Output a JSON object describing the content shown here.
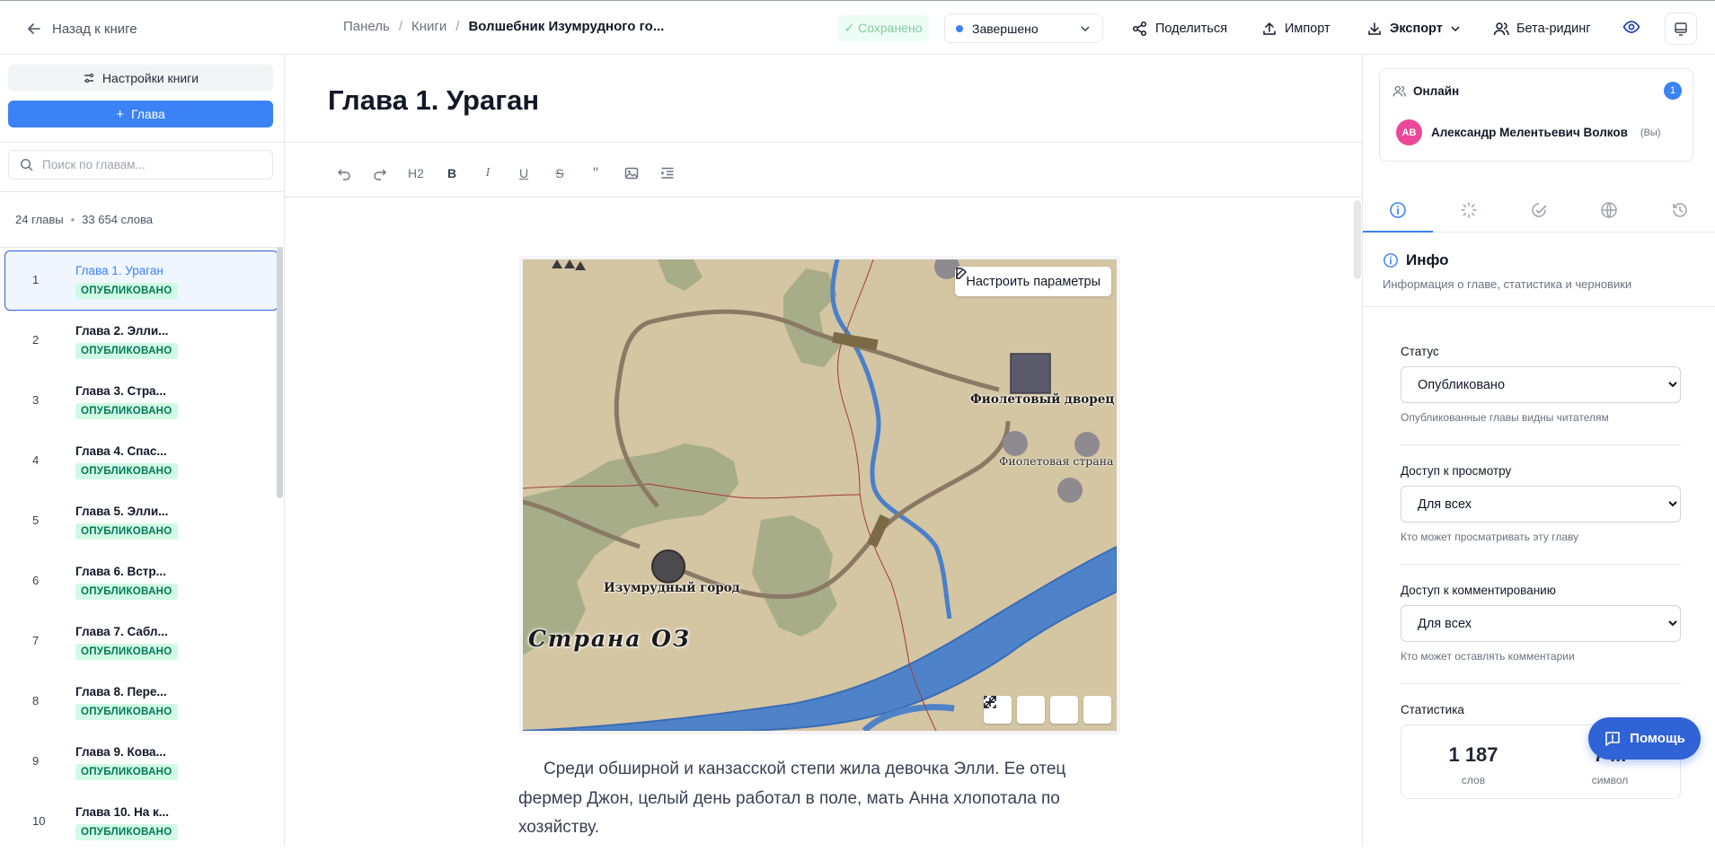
{
  "header": {
    "back_label": "Назад к книге",
    "breadcrumbs": [
      "Панель",
      "Книги",
      "Волшебник Изумрудного го..."
    ],
    "saved_label": "✓ Сохранено",
    "status_value": "Завершено",
    "share_label": "Поделиться",
    "import_label": "Импорт",
    "export_label": "Экспорт",
    "beta_label": "Бета-ридинг",
    "accent_color": "#3b82f6"
  },
  "sidebar": {
    "settings_label": "Настройки книги",
    "add_chapter_label": "Глава",
    "search_placeholder": "Поиск по главам...",
    "chapters_count": "24 главы",
    "words_count": "33 654 слова",
    "chapters": [
      {
        "num": "1",
        "title": "Глава 1. Ураган",
        "status": "ОПУБЛИКОВАНО"
      },
      {
        "num": "2",
        "title": "Глава 2. Элли...",
        "status": "ОПУБЛИКОВАНО"
      },
      {
        "num": "3",
        "title": "Глава 3. Стра...",
        "status": "ОПУБЛИКОВАНО"
      },
      {
        "num": "4",
        "title": "Глава 4. Спас...",
        "status": "ОПУБЛИКОВАНО"
      },
      {
        "num": "5",
        "title": "Глава 5. Элли...",
        "status": "ОПУБЛИКОВАНО"
      },
      {
        "num": "6",
        "title": "Глава 6. Встр...",
        "status": "ОПУБЛИКОВАНО"
      },
      {
        "num": "7",
        "title": "Глава 7. Сабл...",
        "status": "ОПУБЛИКОВАНО"
      },
      {
        "num": "8",
        "title": "Глава 8. Пере...",
        "status": "ОПУБЛИКОВАНО"
      },
      {
        "num": "9",
        "title": "Глава 9. Кова...",
        "status": "ОПУБЛИКОВАНО"
      },
      {
        "num": "10",
        "title": "Глава 10. На к...",
        "status": "ОПУБЛИКОВАНО"
      }
    ]
  },
  "editor": {
    "chapter_title": "Глава 1. Ураган",
    "toolbar": {
      "h2": "H2",
      "bold": "B",
      "italic": "I",
      "underline": "U",
      "strike": "S",
      "quote": "\""
    },
    "map": {
      "configure_label": "Настроить параметры",
      "city_emerald": "Изумрудный город",
      "city_violet_palace": "Фиолетовый дворец",
      "region_violet": "Фиолетовая страна",
      "country": "Страна ОЗ"
    },
    "paragraph": "Среди обширной и канзасской степи жила девочка Элли. Ее отец фермер Джон, целый день работал в поле, мать Анна хлопотала по хозяйству."
  },
  "right_panel": {
    "online_label": "Онлайн",
    "online_count": "1",
    "user_initials": "АВ",
    "user_name": "Александр Мелентьевич Волков",
    "user_you": "(Вы)",
    "info_title": "Инфо",
    "info_subtitle": "Информация о главе, статистика и черновики",
    "status_label": "Статус",
    "status_value": "Опубликовано",
    "status_hint": "Опубликованные главы видны читателям",
    "view_label": "Доступ к просмотру",
    "view_value": "Для всех",
    "view_hint": "Кто может просматривать эту главу",
    "comment_label": "Доступ к комментированию",
    "comment_value": "Для всех",
    "comment_hint": "Кто может оставлять комментарии",
    "stats_label": "Статистика",
    "words_value": "1 187",
    "words_key": "слов",
    "chars_value": "7 ...",
    "chars_key": "символ"
  },
  "help_label": "Помощь"
}
